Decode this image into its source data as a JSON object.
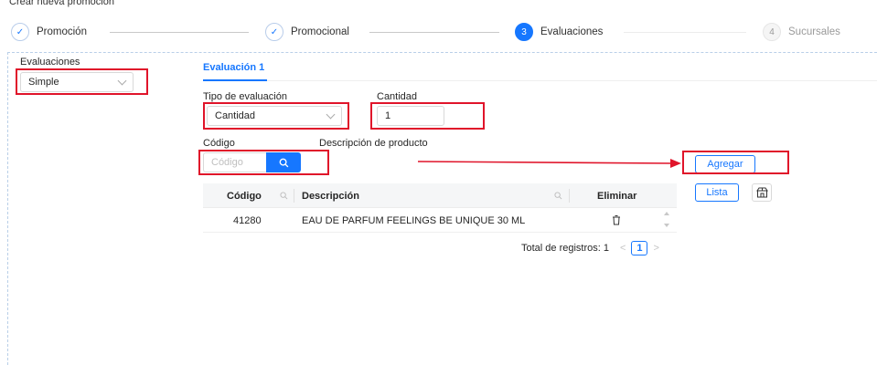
{
  "page_title": "Crear nueva promoción",
  "steps": [
    {
      "index": "✓",
      "label": "Promoción",
      "status": "done"
    },
    {
      "index": "✓",
      "label": "Promocional",
      "status": "done"
    },
    {
      "index": "3",
      "label": "Evaluaciones",
      "status": "active"
    },
    {
      "index": "4",
      "label": "Sucursales",
      "status": "wait"
    }
  ],
  "evaluaciones": {
    "label": "Evaluaciones",
    "value": "Simple"
  },
  "tab": {
    "label": "Evaluación 1"
  },
  "tipo_evaluacion": {
    "label": "Tipo de evaluación",
    "value": "Cantidad"
  },
  "cantidad": {
    "label": "Cantidad",
    "value": "1"
  },
  "codigo": {
    "label": "Código",
    "placeholder": "Código"
  },
  "descripcion_label": "Descripción de producto",
  "buttons": {
    "agregar": "Agregar",
    "lista": "Lista"
  },
  "table": {
    "headers": {
      "codigo": "Código",
      "descripcion": "Descripción",
      "eliminar": "Eliminar"
    },
    "rows": [
      {
        "codigo": "41280",
        "descripcion": "EAU DE PARFUM FEELINGS BE UNIQUE 30 ML"
      }
    ]
  },
  "pagination": {
    "total_label": "Total de registros: 1",
    "current_page": "1"
  },
  "colors": {
    "accent": "#1677ff",
    "annotation": "#e0142a"
  },
  "icons": [
    "check-icon",
    "search-icon",
    "chevron-down-icon",
    "trash-icon",
    "filter-search-icon",
    "store-icon",
    "arrow-right-icon"
  ]
}
